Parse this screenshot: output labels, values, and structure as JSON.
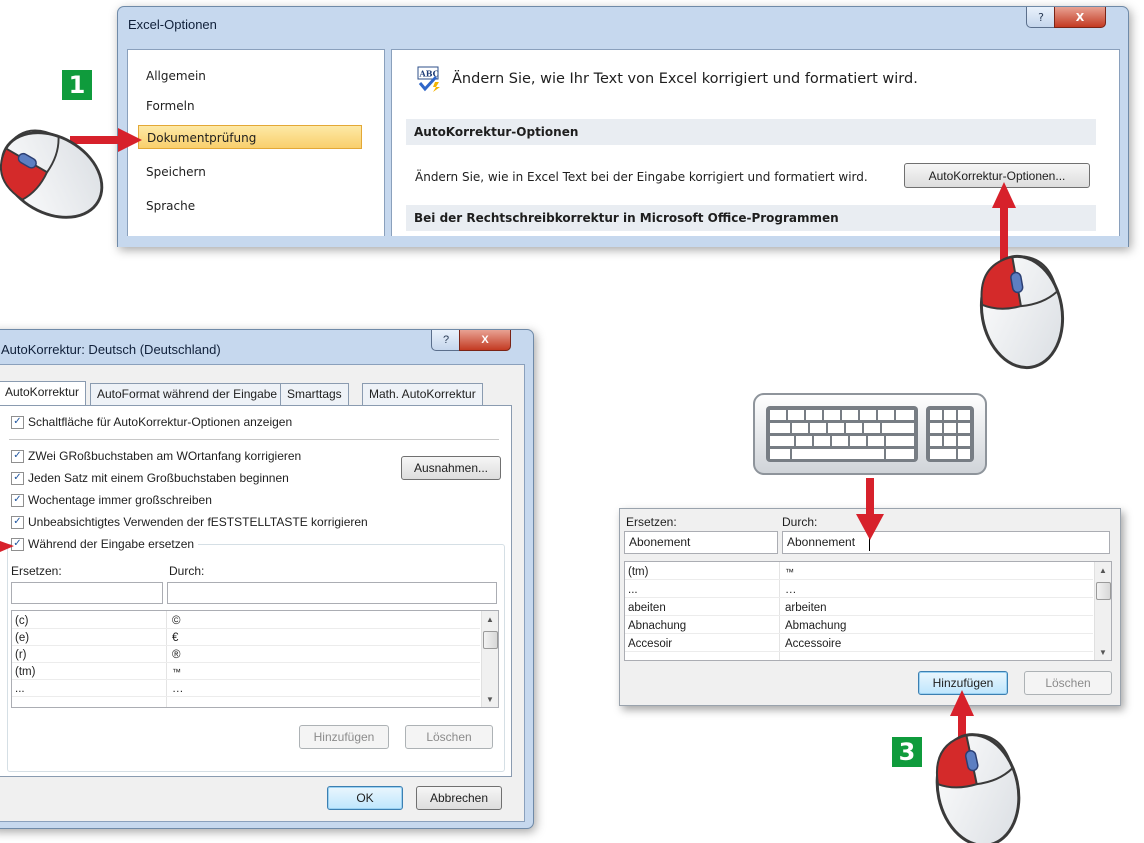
{
  "excel_options": {
    "title": "Excel-Optionen",
    "nav": [
      "Allgemein",
      "Formeln",
      "Dokumentprüfung",
      "Speichern",
      "Sprache"
    ],
    "header_text": "Ändern Sie, wie Ihr Text von Excel korrigiert und formatiert wird.",
    "section_autocorrect": "AutoKorrektur-Optionen",
    "autocorrect_desc": "Ändern Sie, wie in Excel Text bei der Eingabe korrigiert und formatiert wird.",
    "autocorrect_button": "AutoKorrektur-Optionen...",
    "section_spelling": "Bei der Rechtschreibkorrektur in Microsoft Office-Programmen",
    "help_glyph": "?",
    "close_glyph": "X"
  },
  "autocorrect_dialog": {
    "title": "AutoKorrektur: Deutsch (Deutschland)",
    "tabs": [
      "AutoKorrektur",
      "AutoFormat während der Eingabe",
      "Smarttags",
      "Math. AutoKorrektur"
    ],
    "check_show_button": "Schaltfläche für AutoKorrektur-Optionen anzeigen",
    "checks": [
      "ZWei GRoßbuchstaben am WOrtanfang korrigieren",
      "Jeden Satz mit einem Großbuchstaben beginnen",
      "Wochentage immer großschreiben",
      "Unbeabsichtigtes Verwenden der fESTSTELLTASTE korrigieren"
    ],
    "exceptions_button": "Ausnahmen...",
    "replace_check": "Während der Eingabe ersetzen",
    "replace_label": "Ersetzen:",
    "with_label": "Durch:",
    "replace_value": "",
    "with_value": "",
    "rows": [
      {
        "from": "(c)",
        "to": "©"
      },
      {
        "from": "(e)",
        "to": "€"
      },
      {
        "from": "(r)",
        "to": "®"
      },
      {
        "from": "(tm)",
        "to": "™"
      },
      {
        "from": "...",
        "to": "…"
      }
    ],
    "add_button": "Hinzufügen",
    "delete_button": "Löschen",
    "ok_button": "OK",
    "cancel_button": "Abbrechen"
  },
  "replace_panel": {
    "replace_label": "Ersetzen:",
    "with_label": "Durch:",
    "replace_value": "Abonement",
    "with_value": "Abonnement",
    "rows": [
      {
        "from": "(tm)",
        "to": "™"
      },
      {
        "from": "...",
        "to": "…"
      },
      {
        "from": "abeiten",
        "to": "arbeiten"
      },
      {
        "from": "Abnachung",
        "to": "Abmachung"
      },
      {
        "from": "Accesoir",
        "to": "Accessoire"
      }
    ],
    "add_button": "Hinzufügen",
    "delete_button": "Löschen"
  },
  "steps": [
    "1",
    "3"
  ],
  "colors": {
    "arrow": "#d7212b",
    "badge": "#0f9b3c",
    "selected_nav": "#f9cf6c"
  }
}
